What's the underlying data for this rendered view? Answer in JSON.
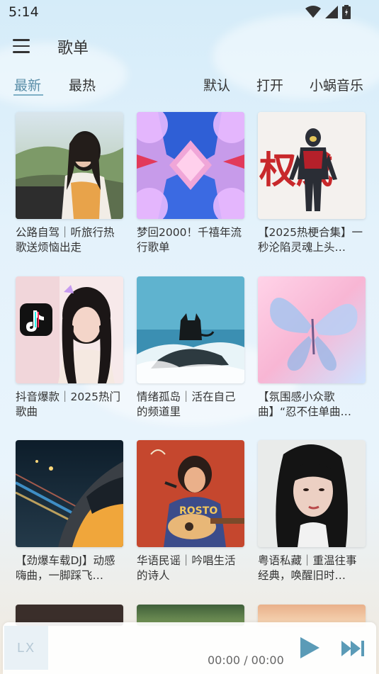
{
  "status_bar": {
    "time": "5:14"
  },
  "header": {
    "title": "歌单"
  },
  "tabs": {
    "latest": "最新",
    "hot": "最热",
    "default": "默认",
    "open": "打开",
    "source": "小蜗音乐"
  },
  "playlists": [
    {
      "title": "公路自驾｜听旅行热歌送烦恼出走"
    },
    {
      "title": "梦回2000！千禧年流行歌单"
    },
    {
      "title": "【2025热梗合集】一秒沦陷灵魂上头…"
    },
    {
      "title": "抖音爆款｜2025热门歌曲"
    },
    {
      "title": "情绪孤岛｜活在自己的频道里"
    },
    {
      "title": "【氛围感小众歌曲】“忍不住单曲…"
    },
    {
      "title": "【劲爆车载DJ】动感嗨曲，一脚踩飞…"
    },
    {
      "title": "华语民谣｜吟唱生活的诗人"
    },
    {
      "title": "粤语私藏｜重温往事经典，唤醒旧时…"
    }
  ],
  "cover_text": {
    "tiktok_b_text": "权威",
    "shirt_text": "ROSTO"
  },
  "player": {
    "cover_placeholder": "LX",
    "time": "00:00 / 00:00"
  },
  "icons": [
    "menu-icon",
    "wifi-icon",
    "signal-icon",
    "battery-icon",
    "play-icon",
    "skip-next-icon"
  ],
  "colors": {
    "accent": "#5a8ea8",
    "play": "#5b9bb7"
  }
}
